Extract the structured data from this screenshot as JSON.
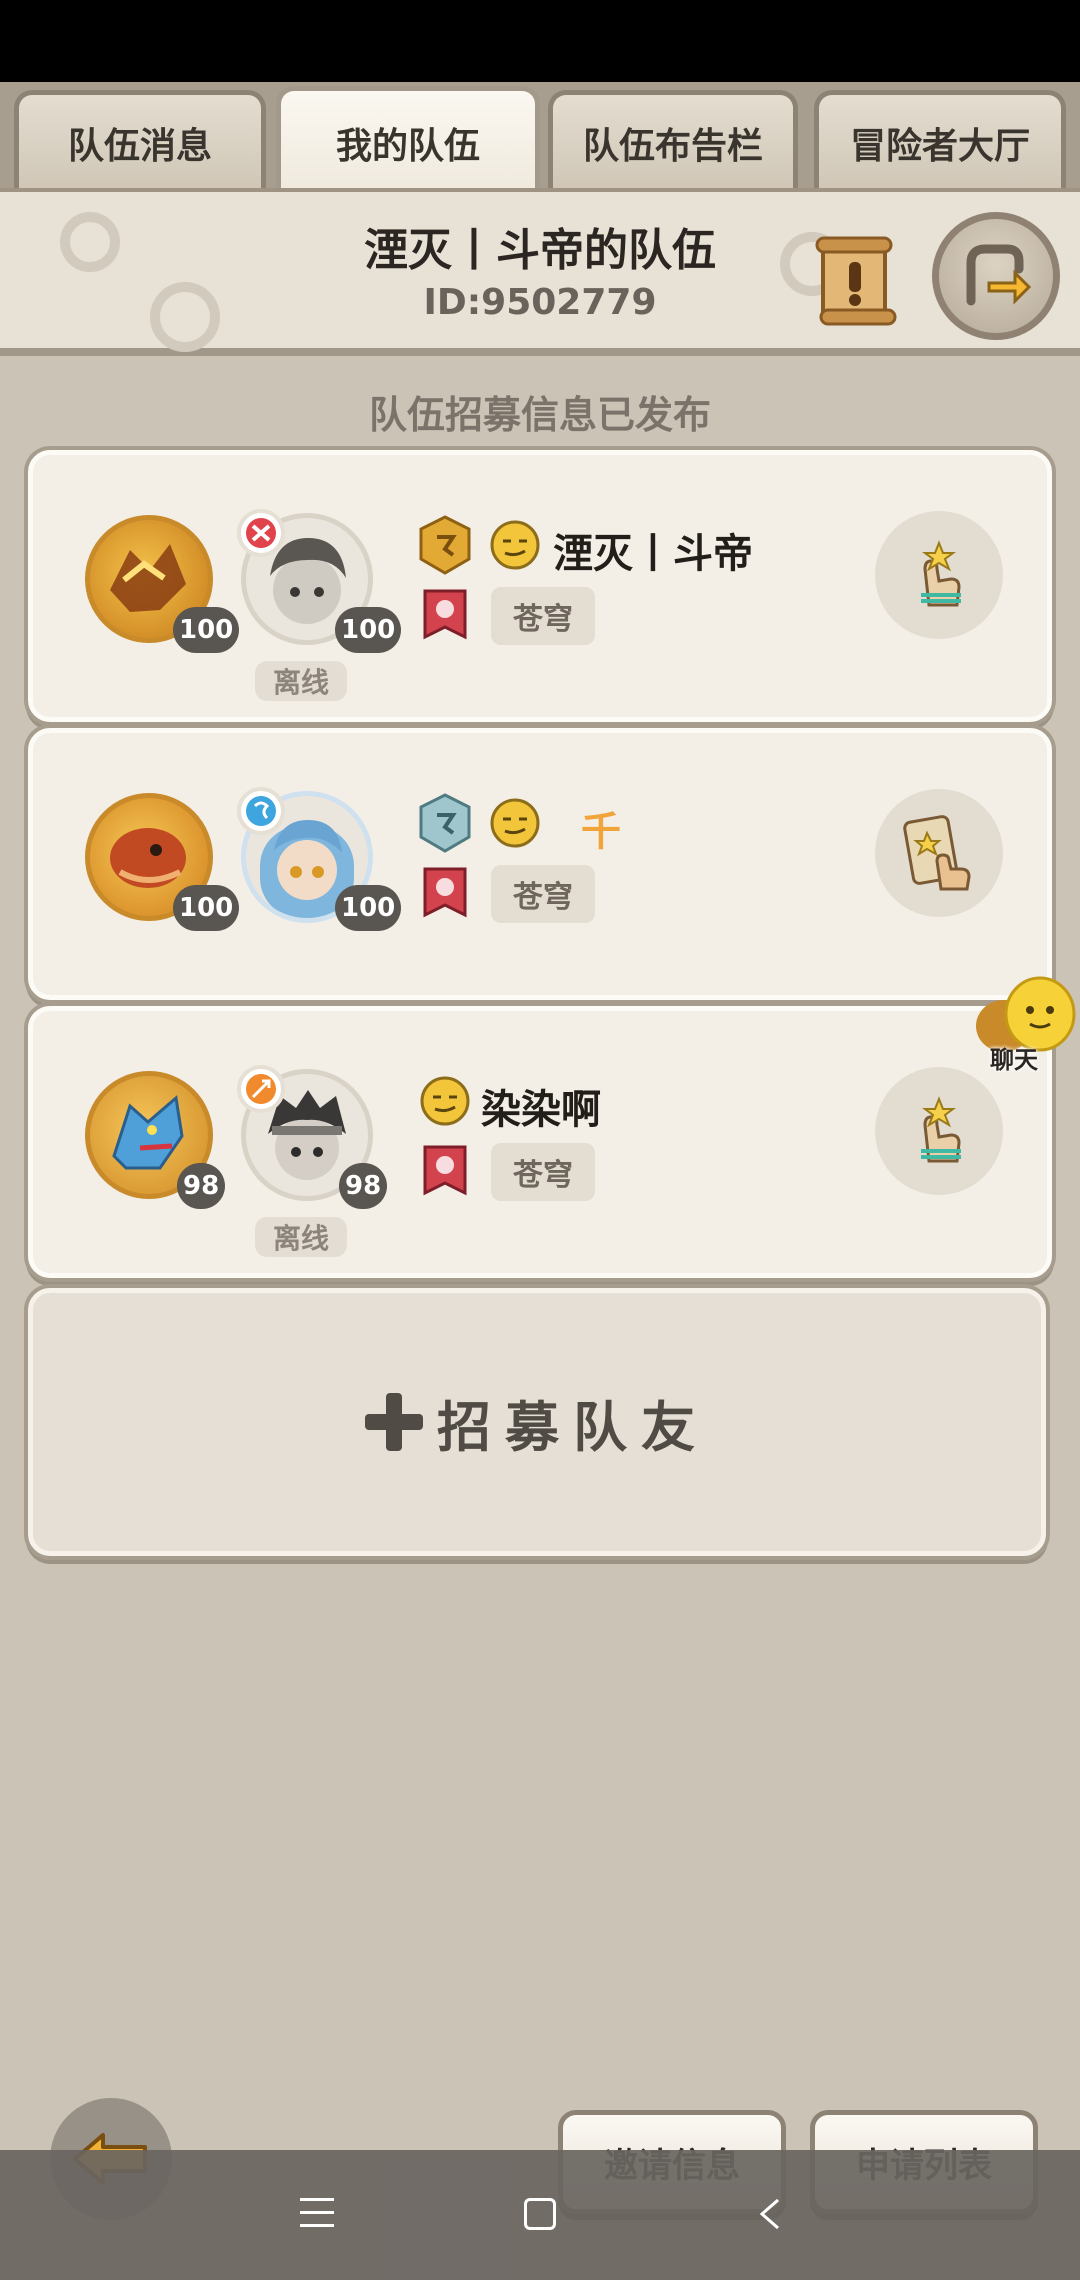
{
  "tabs": [
    {
      "label": "队伍消息",
      "active": false
    },
    {
      "label": "我的队伍",
      "active": true
    },
    {
      "label": "队伍布告栏",
      "active": false
    },
    {
      "label": "冒险者大厅",
      "active": false
    }
  ],
  "header": {
    "title": "湮灭丨斗帝的队伍",
    "id_text": "ID:9502779"
  },
  "published_text": "队伍招募信息已发布",
  "members": [
    {
      "name": "湮灭丨斗帝",
      "pet_level": "100",
      "hero_level": "100",
      "status": "离线",
      "server": "苍穹"
    },
    {
      "name": "千",
      "pet_level": "100",
      "hero_level": "100",
      "status": "",
      "server": "苍穹"
    },
    {
      "name": "染染啊",
      "pet_level": "98",
      "hero_level": "98",
      "status": "离线",
      "server": "苍穹"
    }
  ],
  "recruit": {
    "label": "招募队友"
  },
  "chat": {
    "label": "聊天"
  },
  "bottom": {
    "invite_label": "邀请信息",
    "apply_label": "申请列表"
  },
  "colors": {
    "background": "#cbc3b5",
    "card": "#f3efe7",
    "gold_name": "#f1a43a",
    "level_badge": "#595550"
  },
  "icons": {
    "scroll": "scroll-notice-icon",
    "swap_team": "swap-team-icon",
    "rank_gold": "gold-rank-icon",
    "rank_silver": "silver-rank-icon",
    "face": "emoji-face-icon",
    "guild": "guild-flag-icon",
    "transfer": "hand-transfer-icon",
    "card_action": "card-hand-icon",
    "back": "back-arrow-icon"
  }
}
